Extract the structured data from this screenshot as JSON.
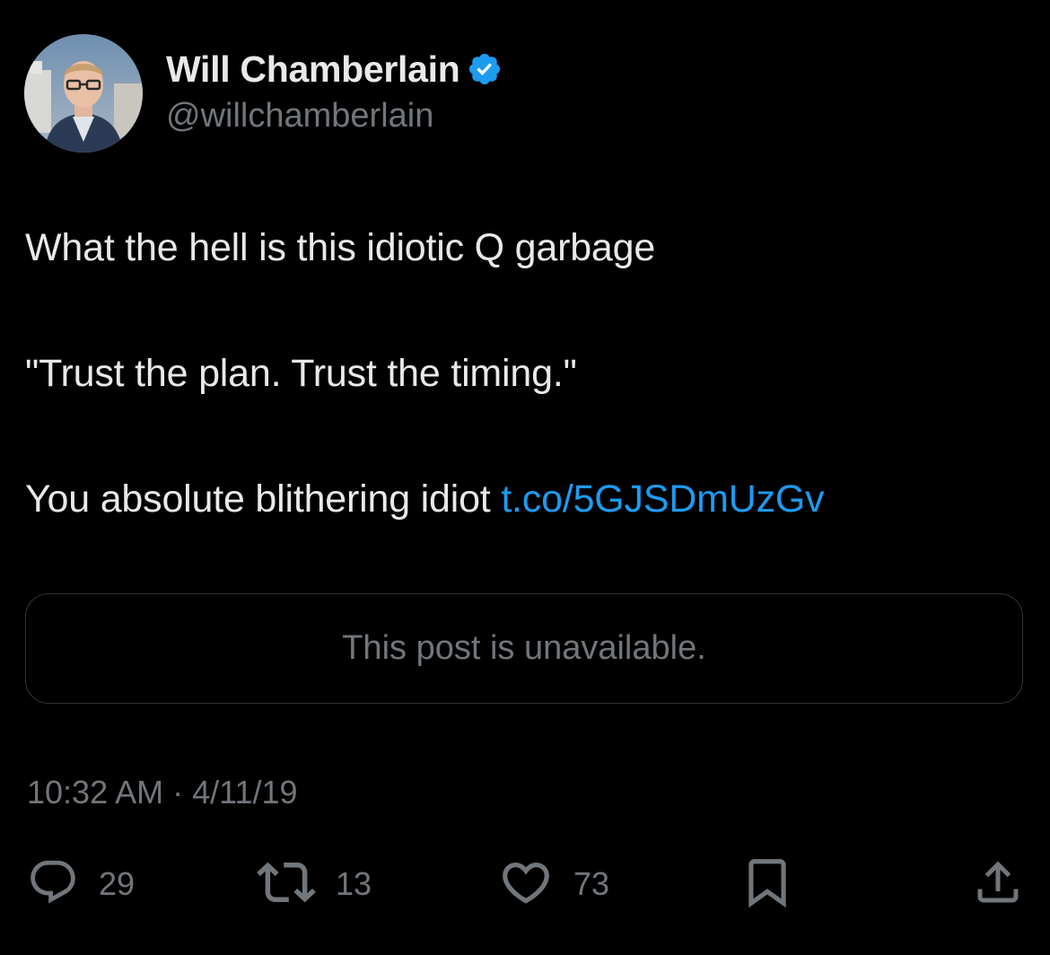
{
  "author": {
    "display_name": "Will Chamberlain",
    "handle": "@willchamberlain",
    "verified": true,
    "verified_color": "#1d9bf0"
  },
  "tweet": {
    "lines": [
      "What the hell is this idiotic Q garbage",
      "\"Trust the plan. Trust the timing.\"",
      "You absolute blithering idiot "
    ],
    "link_text": "t.co/5GJSDmUzGv",
    "link_color": "#1d9bf0"
  },
  "quoted_post": {
    "text": "This post is unavailable."
  },
  "timestamp": "10:32 AM · 4/11/19",
  "actions": {
    "reply_count": "29",
    "repost_count": "13",
    "like_count": "73"
  },
  "icons": {
    "avatar": "profile-photo",
    "verified": "verified-badge-icon",
    "reply": "reply-bubble-icon",
    "repost": "repost-arrows-icon",
    "like": "heart-icon",
    "bookmark": "bookmark-icon",
    "share": "share-upload-icon"
  },
  "colors": {
    "background": "#000000",
    "primary_text": "#e7e9ea",
    "secondary_text": "#71767b",
    "border": "#2f3336"
  }
}
